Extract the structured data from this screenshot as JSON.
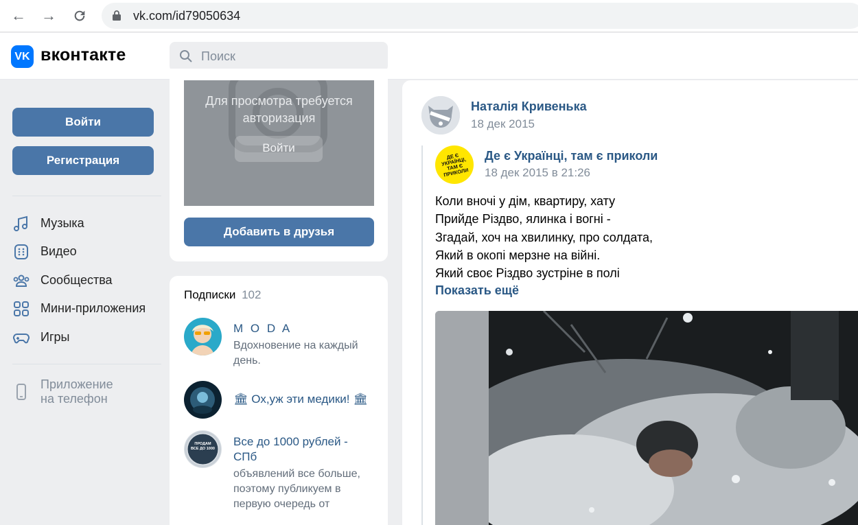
{
  "browser": {
    "url": "vk.com/id79050634"
  },
  "header": {
    "logo_text": "VK",
    "brand": "вконтакте",
    "search_placeholder": "Поиск"
  },
  "sidebar": {
    "login_label": "Войти",
    "register_label": "Регистрация",
    "items": [
      {
        "icon": "music-note-icon",
        "label": "Музыка"
      },
      {
        "icon": "video-icon",
        "label": "Видео"
      },
      {
        "icon": "community-icon",
        "label": "Сообщества"
      },
      {
        "icon": "mini-apps-icon",
        "label": "Мини-приложения"
      },
      {
        "icon": "gamepad-icon",
        "label": "Игры"
      }
    ],
    "app_link_line1": "Приложение",
    "app_link_line2": "на телефон"
  },
  "profile": {
    "photo_auth_line1": "Для просмотра требуется",
    "photo_auth_line2": "авторизация",
    "photo_login_label": "Войти",
    "add_friend_label": "Добавить в друзья"
  },
  "subscriptions": {
    "title": "Подписки",
    "count": "102",
    "items": [
      {
        "name": "M O D A",
        "desc": "Вдохновение на каждый день."
      },
      {
        "name": "🏛 Ох,уж эти медики! 🏛",
        "desc": ""
      },
      {
        "name": "Все до 1000 рублей - СПб",
        "desc": "объявлений все больше, поэтому публикуем в первую очередь от",
        "avatar_text": "ПРОДАМ ВСЕ ДО 1000"
      }
    ]
  },
  "post": {
    "author": "Наталія Кривенька",
    "date": "18 дек 2015",
    "repost": {
      "group_name": "Де є Українці, там є приколи",
      "group_avatar_text": "ДЕ Є УКРАЇНЦІ, ТАМ Є ПРИКОЛИ",
      "date": "18 дек 2015 в 21:26",
      "text_lines": [
        "Коли вночі у дім, квартиру, хату",
        "Прийде Різдво, ялинка і вогні -",
        "Згадай, хоч на хвилинку, про солдата,",
        "Який в окопі мерзне на війні.",
        "Який своє Різдво зустріне в полі"
      ],
      "show_more": "Показать ещё"
    }
  },
  "colors": {
    "accent": "#4a76a8",
    "link": "#2a5885",
    "vk_blue": "#0077ff",
    "background": "#edeef0"
  }
}
